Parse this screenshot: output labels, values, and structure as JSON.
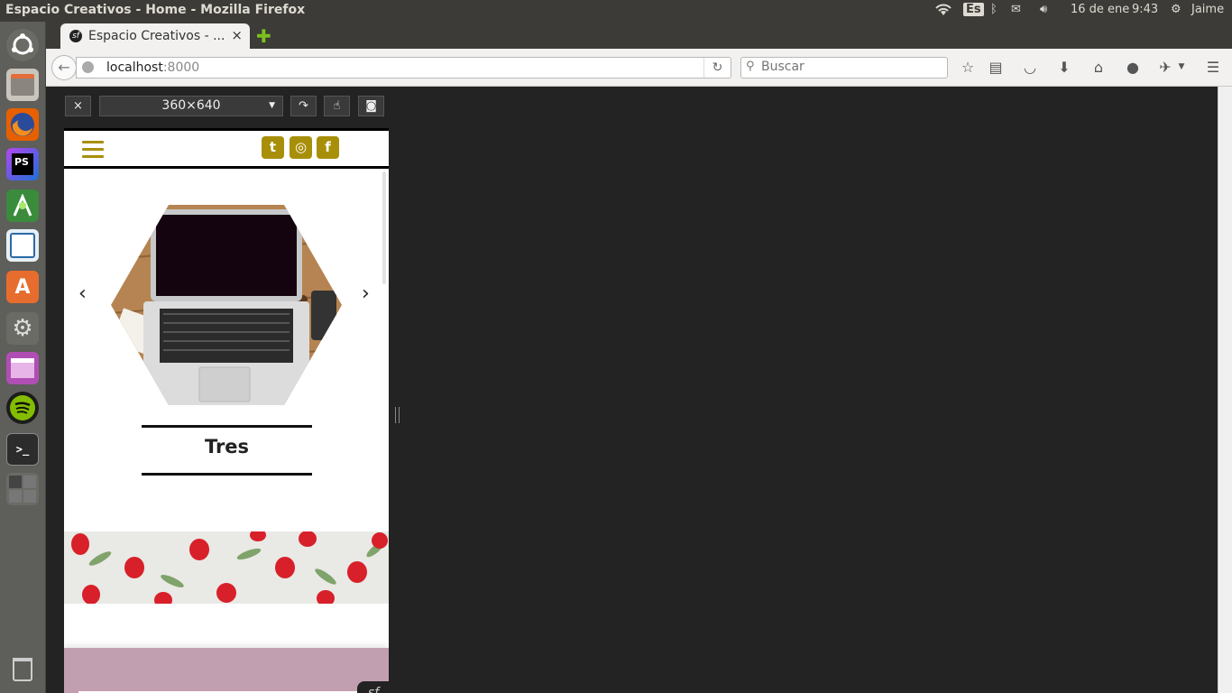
{
  "window": {
    "title": "Espacio Creativos - Home - Mozilla Firefox"
  },
  "panel": {
    "lang": "Es",
    "date": "16 de ene",
    "time": "9:43",
    "user": "Jaime"
  },
  "launcher": {
    "items": [
      {
        "name": "ubuntu-dash-icon"
      },
      {
        "name": "files-icon"
      },
      {
        "name": "firefox-icon"
      },
      {
        "name": "phpstorm-icon",
        "label": "PS"
      },
      {
        "name": "android-studio-icon"
      },
      {
        "name": "mysql-workbench-icon"
      },
      {
        "name": "software-center-icon"
      },
      {
        "name": "system-settings-icon"
      },
      {
        "name": "app-window-icon"
      },
      {
        "name": "spotify-icon"
      },
      {
        "name": "terminal-icon"
      },
      {
        "name": "workspace-switcher-icon"
      },
      {
        "name": "trash-icon"
      }
    ]
  },
  "tab": {
    "label": "Espacio Creativos - ...",
    "close": "×"
  },
  "nav": {
    "host": "localhost",
    "port": ":8000",
    "search_placeholder": "Buscar"
  },
  "rdm": {
    "close": "×",
    "size": "360×640"
  },
  "site": {
    "slide_title": "Tres",
    "social": [
      {
        "name": "twitter-icon",
        "glyph": "t"
      },
      {
        "name": "instagram-icon",
        "glyph": "◎"
      },
      {
        "name": "facebook-icon",
        "glyph": "f"
      }
    ],
    "prev": "‹",
    "next": "›"
  },
  "colors": {
    "accent": "#a88f09",
    "panel": "#3c3b37",
    "pink": "#c29fb0"
  }
}
